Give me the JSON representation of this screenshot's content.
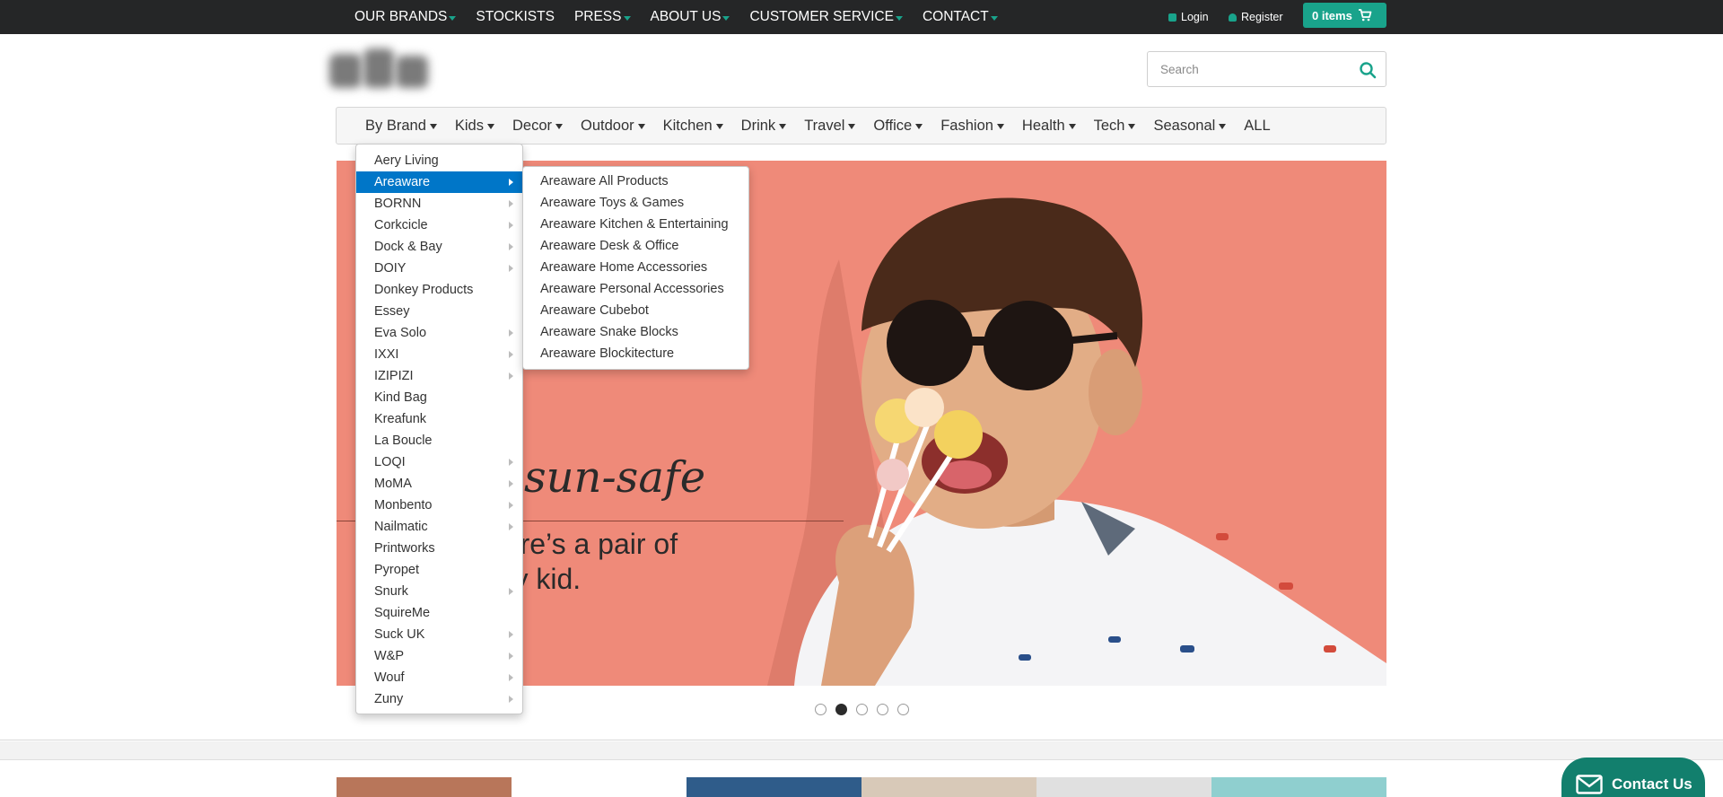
{
  "top_nav": {
    "items": [
      {
        "label": "OUR BRANDS",
        "dropdown": true
      },
      {
        "label": "STOCKISTS",
        "dropdown": false
      },
      {
        "label": "PRESS",
        "dropdown": true
      },
      {
        "label": "ABOUT US",
        "dropdown": true
      },
      {
        "label": "CUSTOMER SERVICE",
        "dropdown": true
      },
      {
        "label": "CONTACT",
        "dropdown": true
      }
    ],
    "login_label": "Login",
    "register_label": "Register",
    "cart_label": "0 items"
  },
  "search": {
    "placeholder": "Search"
  },
  "category_nav": {
    "items": [
      "By Brand",
      "Kids",
      "Decor",
      "Outdoor",
      "Kitchen",
      "Drink",
      "Travel",
      "Office",
      "Fashion",
      "Health",
      "Tech",
      "Seasonal",
      "ALL"
    ]
  },
  "brand_menu": {
    "items": [
      {
        "label": "Aery Living",
        "submenu": false
      },
      {
        "label": "Areaware",
        "submenu": true,
        "highlighted": true
      },
      {
        "label": "BORNN",
        "submenu": true
      },
      {
        "label": "Corkcicle",
        "submenu": true
      },
      {
        "label": "Dock & Bay",
        "submenu": true
      },
      {
        "label": "DOIY",
        "submenu": true
      },
      {
        "label": "Donkey Products",
        "submenu": false
      },
      {
        "label": "Essey",
        "submenu": false
      },
      {
        "label": "Eva Solo",
        "submenu": true
      },
      {
        "label": "IXXI",
        "submenu": true
      },
      {
        "label": "IZIPIZI",
        "submenu": true
      },
      {
        "label": "Kind Bag",
        "submenu": false
      },
      {
        "label": "Kreafunk",
        "submenu": false
      },
      {
        "label": "La Boucle",
        "submenu": false
      },
      {
        "label": "LOQI",
        "submenu": true
      },
      {
        "label": "MoMA",
        "submenu": true
      },
      {
        "label": "Monbento",
        "submenu": true
      },
      {
        "label": "Nailmatic",
        "submenu": true
      },
      {
        "label": "Printworks",
        "submenu": false
      },
      {
        "label": "Pyropet",
        "submenu": false
      },
      {
        "label": "Snurk",
        "submenu": true
      },
      {
        "label": "SquireMe",
        "submenu": false
      },
      {
        "label": "Suck UK",
        "submenu": true
      },
      {
        "label": "W&P",
        "submenu": true
      },
      {
        "label": "Wouf",
        "submenu": true
      },
      {
        "label": "Zuny",
        "submenu": true
      }
    ]
  },
  "areaware_menu": {
    "items": [
      "Areaware All Products",
      "Areaware Toys & Games",
      "Areaware Kitchen & Entertaining",
      "Areaware Desk & Office",
      "Areaware Home Accessories",
      "Areaware Personal Accessories",
      "Areaware Cubebot",
      "Areaware Snake Blocks",
      "Areaware Blockitecture"
    ]
  },
  "hero": {
    "headline": "sun-safe",
    "subline_1": "here’s a pair of",
    "subline_2": "ery kid.",
    "background_color": "#ef8a79"
  },
  "carousel": {
    "slide_count": 5,
    "active_index": 1
  },
  "contact_button": {
    "label": "Contact Us"
  },
  "colors": {
    "accent": "#19a38b",
    "topbar": "#252627",
    "menu_highlight": "#0076c8",
    "contact": "#127f6d"
  },
  "icons": {
    "login": "lock-icon",
    "register": "user-icon",
    "cart": "cart-icon",
    "search": "search-icon",
    "contact": "mail-icon"
  }
}
